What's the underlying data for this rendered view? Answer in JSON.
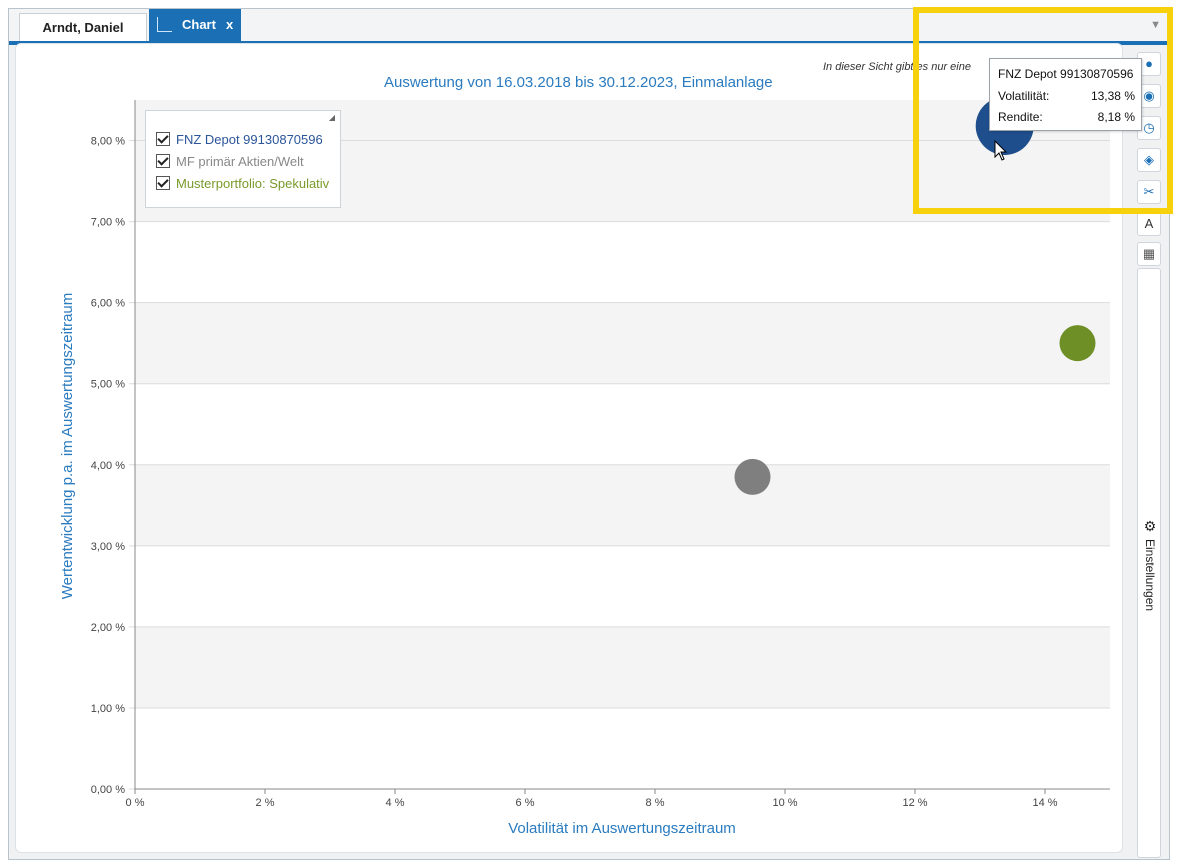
{
  "tabs": {
    "client_tab": "Arndt, Daniel",
    "chart_tab": "Chart",
    "chart_tab_close": "x"
  },
  "header": {
    "title": "Auswertung von 16.03.2018 bis 30.12.2023, Einmalanlage",
    "info_text": "In dieser Sicht gibt es nur eine"
  },
  "legend": {
    "items": [
      {
        "label": "FNZ Depot 99130870596",
        "color": "#2a5599",
        "checked": true
      },
      {
        "label": "MF primär Aktien/Welt",
        "color": "#888888",
        "checked": true
      },
      {
        "label": "Musterportfolio: Spekulativ",
        "color": "#7a9a2c",
        "checked": true
      }
    ]
  },
  "tooltip": {
    "title": "FNZ Depot 99130870596",
    "rows": [
      {
        "key": "Volatilität:",
        "value": "13,38 %"
      },
      {
        "key": "Rendite:",
        "value": "8,18 %"
      }
    ]
  },
  "side_panel": {
    "settings_label": "Einstellungen",
    "buttons": [
      "circle-icon",
      "eye-icon",
      "history-icon",
      "visibility-icon",
      "cut-icon",
      "font-icon",
      "table-icon"
    ]
  },
  "chart_data": {
    "type": "scatter",
    "title": "Auswertung von 16.03.2018 bis 30.12.2023, Einmalanlage",
    "xlabel": "Volatilität im Auswertungszeitraum",
    "ylabel": "Wertentwicklung p.a. im Auswertungszeitraum",
    "xlim": [
      0,
      15
    ],
    "ylim": [
      0,
      8.5
    ],
    "x_ticks": [
      "0 %",
      "2 %",
      "4 %",
      "6 %",
      "8 %",
      "10 %",
      "12 %",
      "14 %"
    ],
    "x_tick_values": [
      0,
      2,
      4,
      6,
      8,
      10,
      12,
      14
    ],
    "y_ticks": [
      "0,00 %",
      "1,00 %",
      "2,00 %",
      "3,00 %",
      "4,00 %",
      "5,00 %",
      "6,00 %",
      "7,00 %",
      "8,00 %"
    ],
    "y_tick_values": [
      0,
      1,
      2,
      3,
      4,
      5,
      6,
      7,
      8
    ],
    "grid": true,
    "legend_position": "top-left",
    "series": [
      {
        "name": "FNZ Depot 99130870596",
        "x": 13.38,
        "y": 8.18,
        "color": "#1f4e8c"
      },
      {
        "name": "MF primär Aktien/Welt",
        "x": 9.5,
        "y": 3.85,
        "color": "#7f7f7f"
      },
      {
        "name": "Musterportfolio: Spekulativ",
        "x": 14.5,
        "y": 5.5,
        "color": "#6e8f26"
      }
    ]
  }
}
